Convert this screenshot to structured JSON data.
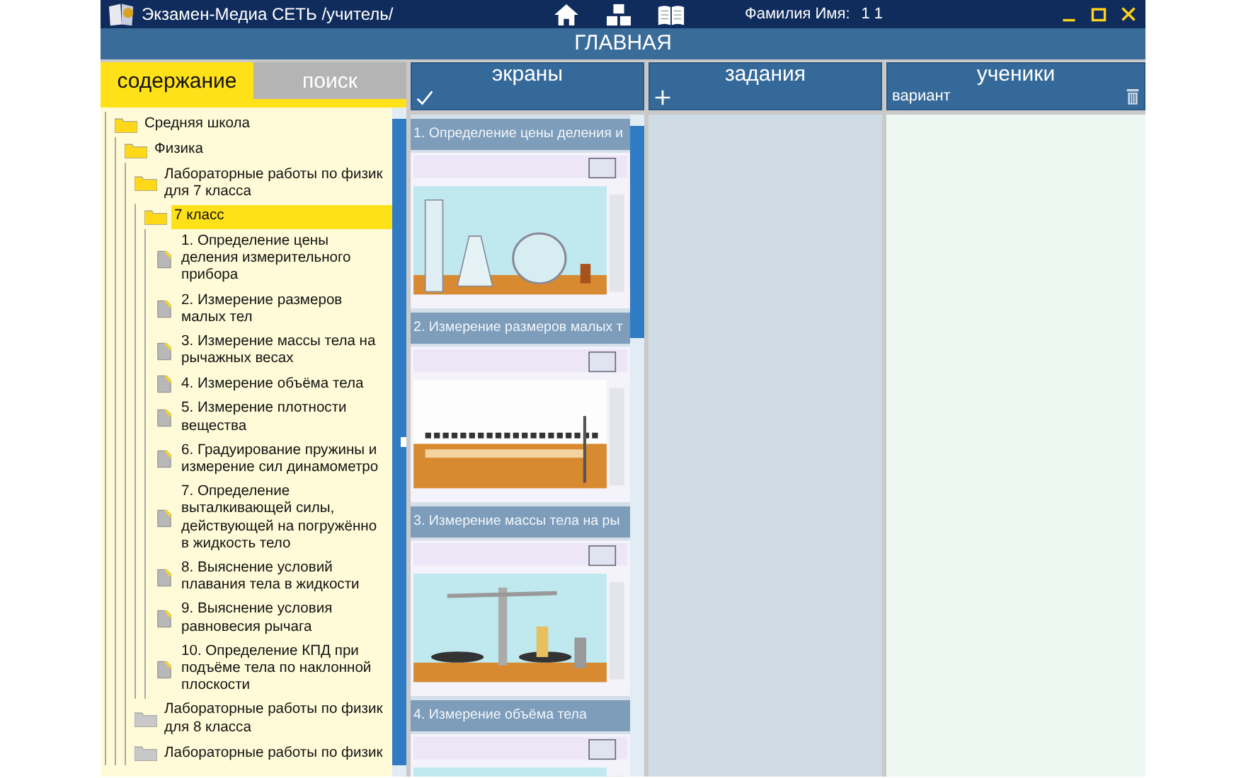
{
  "app": {
    "title": "Экзамен-Медиа СЕТЬ /учитель/",
    "user_label": "Фамилия Имя:",
    "user_value": "1 1",
    "page_title": "ГЛАВНАЯ"
  },
  "left_tabs": [
    {
      "label": "содержание",
      "selected": true
    },
    {
      "label": "поиск",
      "selected": false
    }
  ],
  "tree": [
    {
      "label": "Средняя школа",
      "kind": "folder",
      "expanded": true,
      "selected": false,
      "children": [
        {
          "label": "Физика",
          "kind": "folder",
          "expanded": true,
          "selected": false,
          "children": [
            {
              "label": "Лабораторные работы по физик\nдля 7 класса",
              "kind": "folder",
              "expanded": true,
              "selected": false,
              "children": [
                {
                  "label": "7 класс",
                  "kind": "folder",
                  "expanded": true,
                  "selected": true,
                  "children": [
                    {
                      "label": "1. Определение цены\nделения измерительного\nприбора",
                      "kind": "doc",
                      "selected": false
                    },
                    {
                      "label": "2. Измерение размеров\nмалых тел",
                      "kind": "doc",
                      "selected": false
                    },
                    {
                      "label": "3. Измерение массы тела на\nрычажных весах",
                      "kind": "doc",
                      "selected": false
                    },
                    {
                      "label": "4. Измерение объёма тела",
                      "kind": "doc",
                      "selected": false
                    },
                    {
                      "label": "5. Измерение плотности\nвещества",
                      "kind": "doc",
                      "selected": false
                    },
                    {
                      "label": "6. Градуирование пружины и\nизмерение сил динамометро",
                      "kind": "doc",
                      "selected": false
                    },
                    {
                      "label": "7. Определение\nвыталкивающей силы,\nдействующей на погружённо\nв жидкость тело",
                      "kind": "doc",
                      "selected": false
                    },
                    {
                      "label": "8. Выяснение условий\nплавания тела в жидкости",
                      "kind": "doc",
                      "selected": false
                    },
                    {
                      "label": "9. Выяснение условия\nравновесия рычага",
                      "kind": "doc",
                      "selected": false
                    },
                    {
                      "label": "10. Определение КПД при\nподъёме тела по наклонной\nплоскости",
                      "kind": "doc",
                      "selected": false
                    }
                  ]
                }
              ]
            },
            {
              "label": "Лабораторные работы по физик\nдля 8 класса",
              "kind": "folder",
              "expanded": false,
              "selected": false
            },
            {
              "label": "Лабораторные работы по физик",
              "kind": "folder",
              "expanded": false,
              "selected": false
            }
          ]
        }
      ]
    }
  ],
  "screens": {
    "title": "экраны",
    "items": [
      {
        "title": "1. Определение цены деления и",
        "kind": "picture"
      },
      {
        "title": "2. Измерение размеров малых т",
        "kind": "picture"
      },
      {
        "title": "3. Измерение массы тела на ры",
        "kind": "picture"
      },
      {
        "title": "4. Измерение объёма тела",
        "kind": "picture"
      }
    ]
  },
  "tasks": {
    "title": "задания"
  },
  "students": {
    "title": "ученики",
    "subtitle": "вариант"
  }
}
